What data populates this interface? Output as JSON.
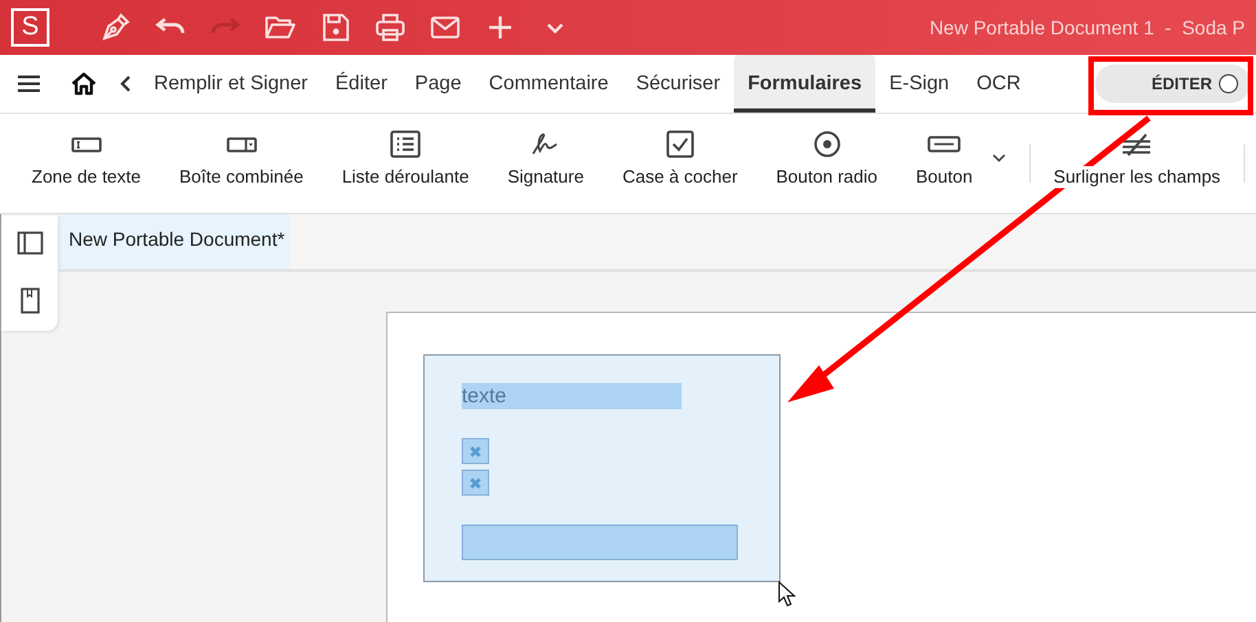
{
  "app": {
    "logo": "S",
    "title": "New Portable Document 1  -  Soda P"
  },
  "quick_access": [
    {
      "disabled": false
    },
    {
      "disabled": false
    },
    {
      "disabled": true
    },
    {
      "disabled": false
    },
    {
      "disabled": false
    },
    {
      "disabled": false
    },
    {
      "disabled": false
    },
    {
      "disabled": false
    },
    {
      "disabled": false
    }
  ],
  "tabs": [
    {
      "label": "Remplir et Signer",
      "selected": false
    },
    {
      "label": "Éditer",
      "selected": false
    },
    {
      "label": "Page",
      "selected": false
    },
    {
      "label": "Commentaire",
      "selected": false
    },
    {
      "label": "Sécuriser",
      "selected": false
    },
    {
      "label": "Formulaires",
      "selected": true
    },
    {
      "label": "E-Sign",
      "selected": false
    },
    {
      "label": "OCR",
      "selected": false
    }
  ],
  "edit_toggle": {
    "label": "ÉDITER",
    "on": false
  },
  "ribbon": [
    {
      "label": "Zone de texte"
    },
    {
      "label": "Boîte combinée"
    },
    {
      "label": "Liste déroulante"
    },
    {
      "label": "Signature"
    },
    {
      "label": "Case à cocher"
    },
    {
      "label": "Bouton radio"
    },
    {
      "label": "Bouton"
    },
    {
      "label": "Surligner les champs"
    }
  ],
  "document_tabs": [
    {
      "label": "New Portable Document*",
      "selected": true
    }
  ],
  "form": {
    "text_field": {
      "value": "texte"
    },
    "checkboxes": [
      {
        "checked": true
      },
      {
        "checked": true
      }
    ],
    "button_field": {
      "present": true
    }
  }
}
